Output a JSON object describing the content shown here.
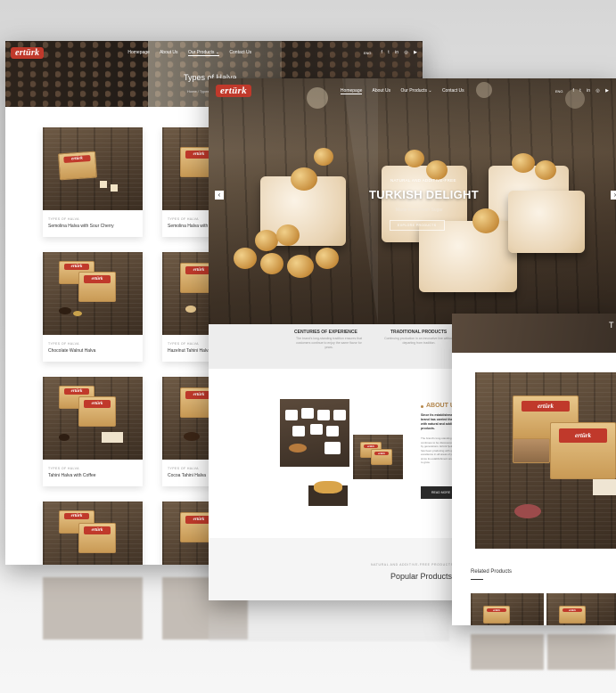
{
  "brand": "ertürk",
  "nav": {
    "items": [
      "Homepage",
      "About Us",
      "Our Products",
      "Contact Us"
    ],
    "active_back": "Our Products",
    "active_front": "Homepage",
    "language": "ENG",
    "dropdown_glyph": "⌄",
    "social_icons": [
      "facebook-icon",
      "twitter-icon",
      "linkedin-icon",
      "instagram-icon",
      "youtube-icon"
    ],
    "social_glyphs": [
      "f",
      "t",
      "in",
      "◎",
      "▶"
    ]
  },
  "back_page": {
    "title": "Types of Halva",
    "breadcrumb": "Home / Types of Halva",
    "products": [
      {
        "category": "TYPES OF HALVA",
        "name": "Semolina Halva with Sour Cherry"
      },
      {
        "category": "TYPES OF HALVA",
        "name": "Semolina Halva with Dried Fruit"
      },
      {
        "category": "TYPES OF HALVA",
        "name": "Chocolate Walnut Halva"
      },
      {
        "category": "TYPES OF HALVA",
        "name": "Hazelnut Tahini Halva"
      },
      {
        "category": "TYPES OF HALVA",
        "name": "Tahini Halva with Coffee"
      },
      {
        "category": "TYPES OF HALVA",
        "name": "Cocoa Tahini Halva"
      },
      {
        "category": "",
        "name": ""
      },
      {
        "category": "",
        "name": ""
      }
    ]
  },
  "front_page": {
    "hero": {
      "kicker": "NATURAL AND ADDITIVE-FREE",
      "title": "TURKISH DELIGHT",
      "subtitle": "Made from Fresh Sugar",
      "button": "EXPLORE PRODUCTS",
      "prev": "‹",
      "next": "›"
    },
    "features": [
      {
        "title": "CENTURIES OF EXPERIENCE",
        "text": "The brand's long-standing tradition ensures that customers continue to enjoy the same flavor for years."
      },
      {
        "title": "TRADITIONAL PRODUCTS",
        "text": "Continuing production in an innovative line without departing from tradition."
      }
    ],
    "about": {
      "title": "ABOUT US",
      "lead": "Since its establishment, the brand has carried the tradition with natural and additive-free products.",
      "body": "The brand's long-standing know-how continues to be discovered and loved by generations. Ertürk Şekerleme has been producing with quality and excellence in all areas of production since its establishment and continues to grow.",
      "button": "READ MORE"
    },
    "popular": {
      "kicker": "NATURAL AND ADDITIVE-FREE PRODUCTS",
      "title": "Popular Products"
    }
  },
  "detail_page": {
    "title_initial": "T",
    "related_title": "Related Products"
  }
}
